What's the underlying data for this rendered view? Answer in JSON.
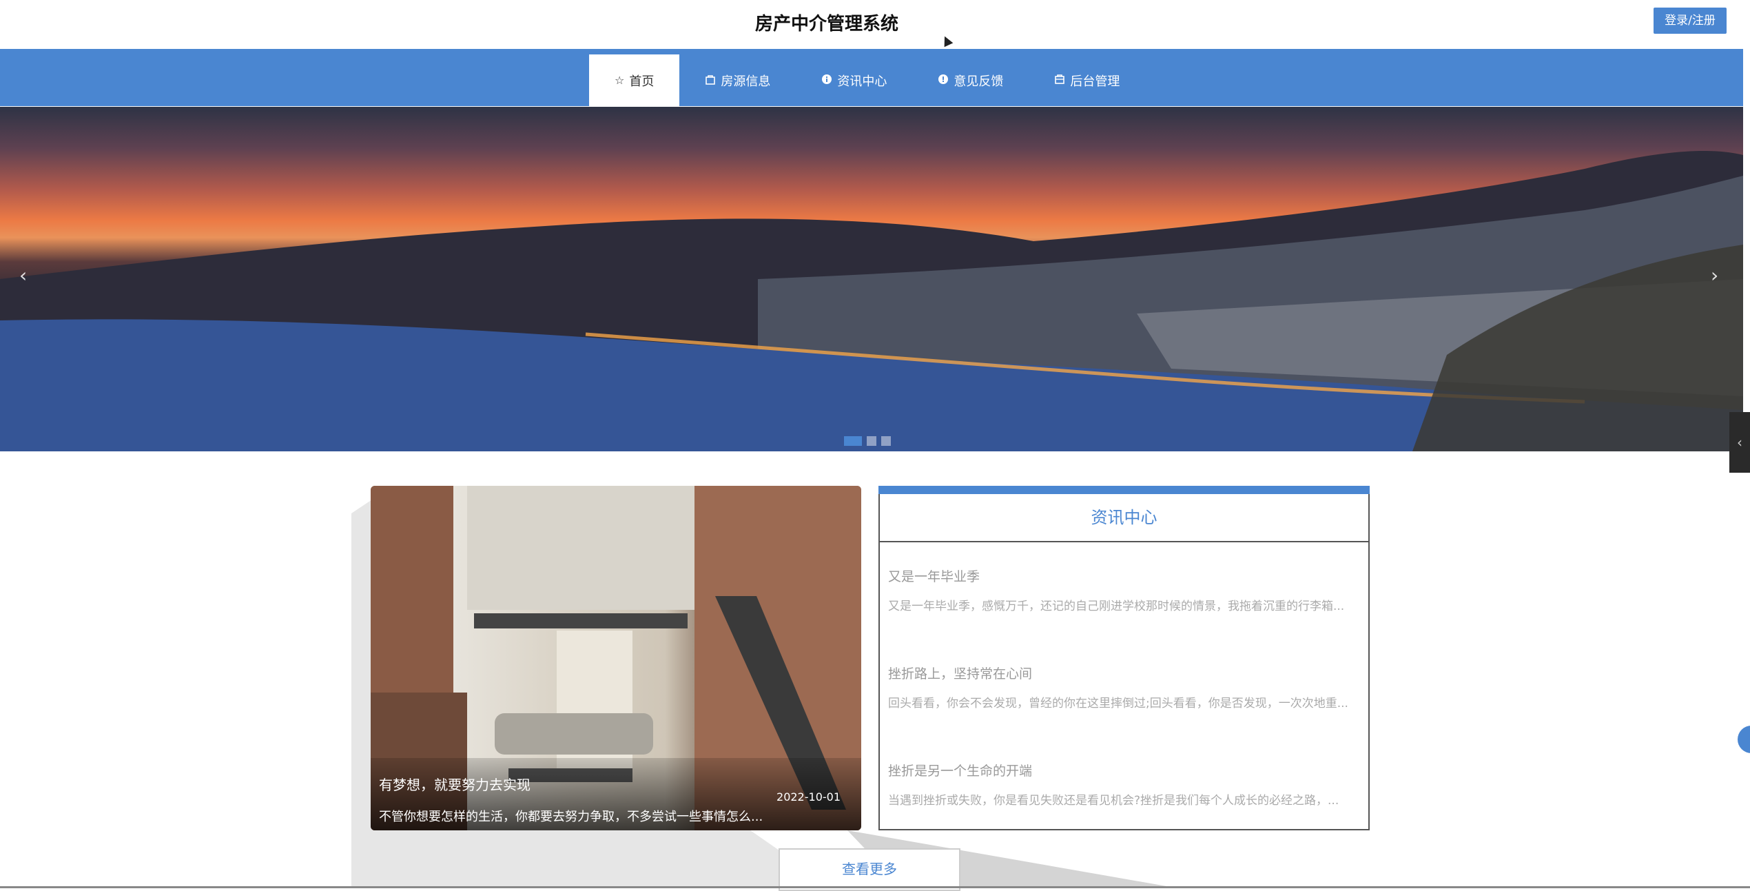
{
  "header": {
    "site_title": "房产中介管理系统",
    "login_label": "登录/注册"
  },
  "nav": {
    "items": [
      {
        "label": "首页",
        "icon": "star-icon",
        "active": true
      },
      {
        "label": "房源信息",
        "icon": "bag-icon",
        "active": false
      },
      {
        "label": "资讯中心",
        "icon": "info-icon",
        "active": false
      },
      {
        "label": "意见反馈",
        "icon": "feedback-icon",
        "active": false
      },
      {
        "label": "后台管理",
        "icon": "admin-icon",
        "active": false
      }
    ]
  },
  "banner": {
    "prev_label": "‹",
    "next_label": "›",
    "slide_count": 3,
    "active_slide": 1
  },
  "feature": {
    "title": "有梦想，就要努力去实现",
    "date": "2022-10-01",
    "desc": "不管你想要怎样的生活，你都要去努力争取，不多尝试一些事情怎么..."
  },
  "news": {
    "heading": "资讯中心",
    "items": [
      {
        "title": "又是一年毕业季",
        "desc": "又是一年毕业季，感慨万千，还记的自己刚进学校那时候的情景，我拖着沉重的行李箱..."
      },
      {
        "title": "挫折路上，坚持常在心间",
        "desc": "回头看看，你会不会发现，曾经的你在这里摔倒过;回头看看，你是否发现，一次次地重..."
      },
      {
        "title": "挫折是另一个生命的开端",
        "desc": "当遇到挫折或失败，你是看见失败还是看见机会?挫折是我们每个人成长的必经之路，..."
      }
    ],
    "more_label": "查看更多"
  },
  "colors": {
    "accent": "#4a86d1",
    "banner_sky": "#ec7a45",
    "banner_water": "#3d5b94"
  }
}
